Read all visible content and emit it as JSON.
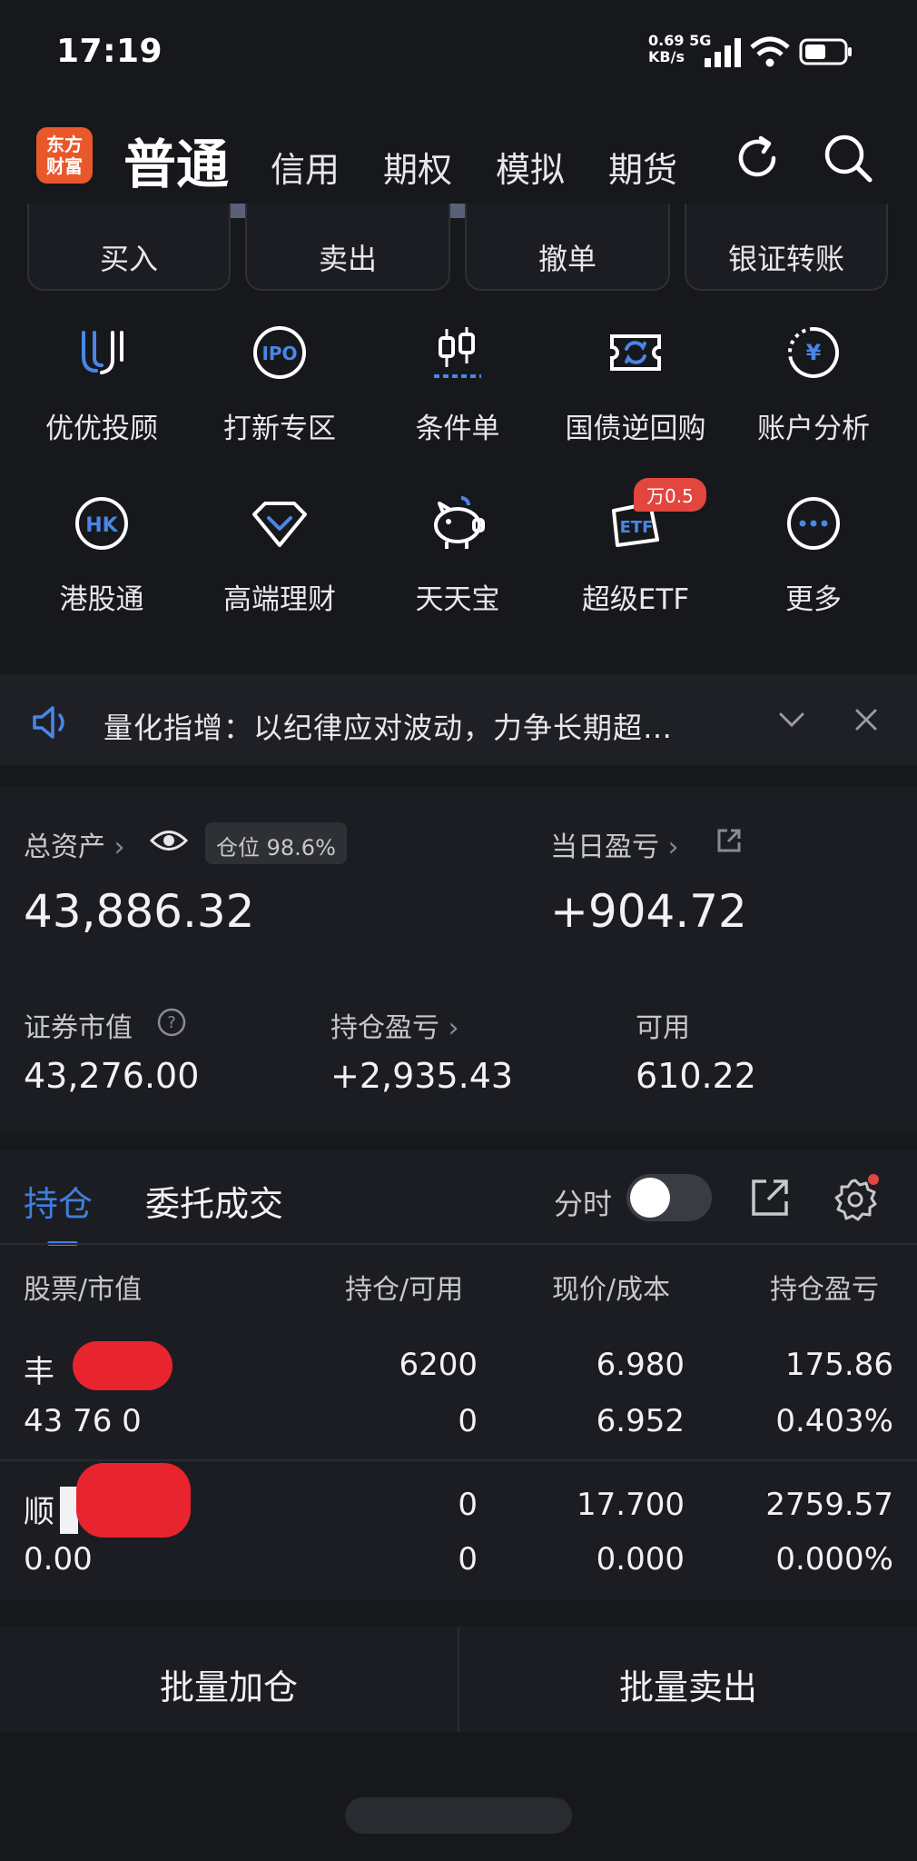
{
  "status_bar": {
    "time": "17:19",
    "net_speed": "0.69",
    "net_unit": "KB/s",
    "net_type": "5G"
  },
  "header": {
    "logo_text_line1": "东方",
    "logo_text_line2": "财富",
    "tabs": [
      {
        "label": "普通",
        "active": true
      },
      {
        "label": "信用"
      },
      {
        "label": "期权"
      },
      {
        "label": "模拟"
      },
      {
        "label": "期货"
      }
    ]
  },
  "trade_buttons": [
    "买入",
    "卖出",
    "撤单",
    "银证转账"
  ],
  "grid": {
    "row1": [
      {
        "label": "优优投顾",
        "icon": "uu-advisor-icon"
      },
      {
        "label": "打新专区",
        "icon": "ipo-icon"
      },
      {
        "label": "条件单",
        "icon": "condition-order-icon"
      },
      {
        "label": "国债逆回购",
        "icon": "bond-repo-icon"
      },
      {
        "label": "账户分析",
        "icon": "account-analysis-icon"
      }
    ],
    "row2": [
      {
        "label": "港股通",
        "icon": "hk-icon"
      },
      {
        "label": "高端理财",
        "icon": "diamond-icon"
      },
      {
        "label": "天天宝",
        "icon": "piggy-bank-icon"
      },
      {
        "label": "超级ETF",
        "icon": "etf-icon"
      },
      {
        "label": "更多",
        "icon": "more-icon"
      }
    ],
    "etf_badge": "万0.5"
  },
  "announcement": {
    "text": "量化指增：以纪律应对波动，力争长期超…"
  },
  "assets": {
    "total_label": "总资产",
    "position_label": "仓位",
    "position_value": "98.6%",
    "total_value": "43,886.32",
    "daily_pl_label": "当日盈亏",
    "daily_pl_value": "+904.72",
    "market_value_label": "证券市值",
    "market_value": "43,276.00",
    "holding_pl_label": "持仓盈亏",
    "holding_pl_value": "+2,935.43",
    "available_label": "可用",
    "available_value": "610.22"
  },
  "holdings": {
    "tabs": [
      "持仓",
      "委托成交"
    ],
    "intraday_label": "分时",
    "columns": [
      "股票/市值",
      "持仓/可用",
      "现价/成本",
      "持仓盈亏"
    ],
    "rows": [
      {
        "name": "丰",
        "market_value": "43 76 0",
        "position": "6200",
        "available": "0",
        "price": "6.980",
        "cost": "6.952",
        "pl": "175.86",
        "pl_pct": "0.403%"
      },
      {
        "name": "顺",
        "market_value": "0.00",
        "position": "0",
        "available": "0",
        "price": "17.700",
        "cost": "0.000",
        "pl": "2759.57",
        "pl_pct": "0.000%"
      }
    ]
  },
  "bottom_buttons": [
    "批量加仓",
    "批量卖出"
  ],
  "colors": {
    "accent_blue": "#3f7fe0",
    "gain_red": "#e2463f",
    "logo_orange": "#e9582b"
  }
}
